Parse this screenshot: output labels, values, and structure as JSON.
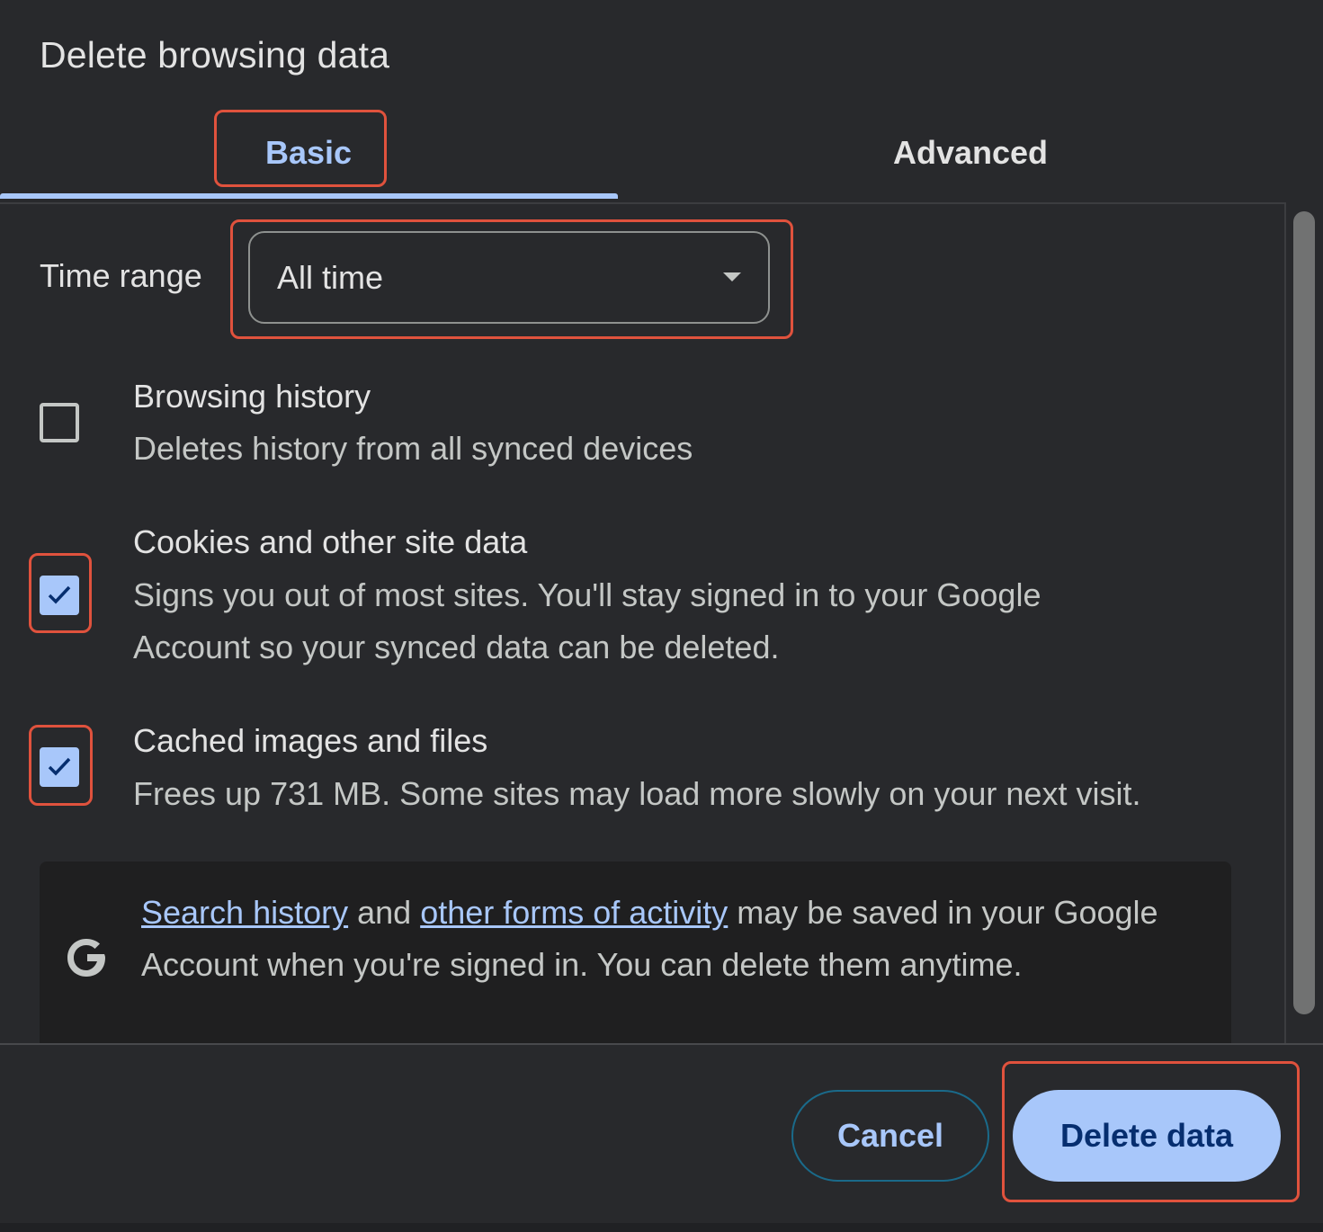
{
  "dialog": {
    "title": "Delete browsing data"
  },
  "tabs": [
    {
      "label": "Basic",
      "selected": true
    },
    {
      "label": "Advanced",
      "selected": false
    }
  ],
  "time_range": {
    "label": "Time range",
    "value": "All time"
  },
  "items": [
    {
      "title": "Browsing history",
      "description": "Deletes history from all synced devices",
      "checked": false
    },
    {
      "title": "Cookies and other site data",
      "description_line1": "Signs you out of most sites. You'll stay signed in to your Google",
      "description_line2": "Account so your synced data can be deleted.",
      "checked": true
    },
    {
      "title": "Cached images and files",
      "description": "Frees up 731 MB. Some sites may load more slowly on your next visit.",
      "checked": true
    }
  ],
  "info": {
    "link1": "Search history",
    "text1": " and ",
    "link2": "other forms of activity",
    "text2": " may be saved in your Google Account when you're signed in. You can delete them anytime."
  },
  "buttons": {
    "cancel": "Cancel",
    "delete": "Delete data"
  },
  "colors": {
    "accent": "#a8c7fa",
    "highlight": "#e0523d",
    "background": "#28292c"
  },
  "icons": {
    "google": "google-g-icon",
    "dropdown": "dropdown-arrow-icon",
    "check": "checkmark-icon"
  }
}
